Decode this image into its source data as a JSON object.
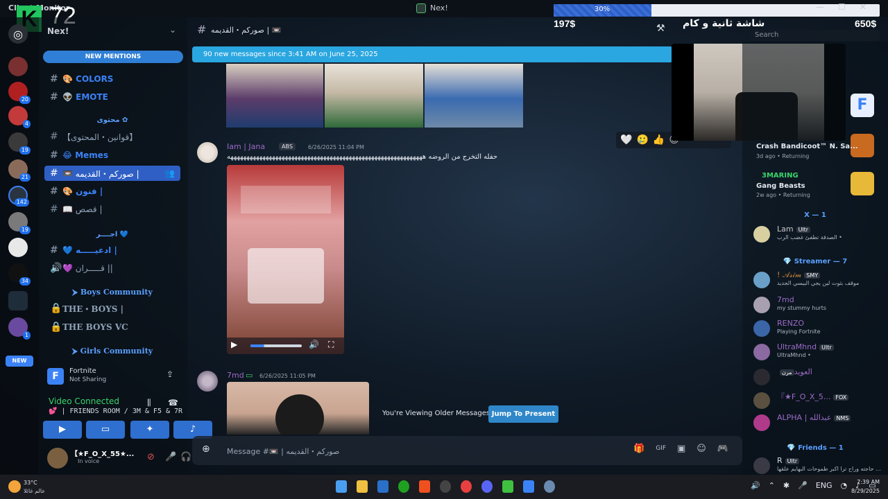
{
  "window": {
    "app_title": "Client Monitor",
    "title": "Nex!"
  },
  "overlay": {
    "logo": "K",
    "count": "72",
    "progress_label": "30%",
    "progress": 0.3,
    "left_amount": "197$",
    "right_amount": "650$",
    "goal_text": "شاشة ثانية و كام",
    "search_placeholder": "Search"
  },
  "server_rail": {
    "badges": [
      "20",
      "4",
      "19",
      "21",
      "142",
      "19",
      "34",
      "1"
    ],
    "new_label": "NEW"
  },
  "sidebar": {
    "server_name": "Nex!",
    "new_mentions": "NEW MENTIONS",
    "channels": [
      {
        "label": "COLORS",
        "emoji": "🎨"
      },
      {
        "label": "EMOTE",
        "emoji": "👽"
      },
      {
        "category": "محتوى ✿"
      },
      {
        "label": "【قوانين・المحتوى】"
      },
      {
        "label": "Memes",
        "emoji": "😂"
      },
      {
        "label": "صوركم・القديمه |",
        "emoji": "📼",
        "active": true
      },
      {
        "label": "فنون |",
        "emoji": "🎨"
      },
      {
        "label": "قصص |",
        "emoji": "📖"
      },
      {
        "category": "اجــــر 💙"
      },
      {
        "label": "ادعيـــــه |",
        "emoji": "💙"
      },
      {
        "label": "قـــــران ||",
        "emoji": "💜"
      },
      {
        "category": "⮞ Boys Community"
      },
      {
        "label": "THE・BOYS |"
      },
      {
        "label": "THE BOYS VC"
      },
      {
        "category": "⮞ Girls Community"
      }
    ],
    "game_activity": {
      "name": "Fortnite",
      "status": "Not Sharing"
    },
    "voice": {
      "status": "Video Connected",
      "room": "💕 | FRIENDS ROOM / 3M & F5 & 7R"
    },
    "user": {
      "name": "【★F_O_X_55★...",
      "status": "In voice"
    }
  },
  "chat": {
    "channel": "صوركم・القديمه | 📼",
    "new_messages_banner": "90 new messages since 3:41 AM on June 25, 2025",
    "messages": [
      {
        "author": "Iam | Jana",
        "tag": "ABS",
        "time": "6/26/2025 11:04 PM",
        "text": "حفله التخرج من الروضه هههههههههههههههههههههههههههههههههههههههههههههههههههههههههههههه"
      },
      {
        "author": "7md",
        "time": "6/26/2025 11:05 PM"
      }
    ],
    "older_notice": "You're Viewing Older Messages",
    "jump_label": "Jump To Present",
    "composer_placeholder": "Message #📼 | صوركم・القديمه"
  },
  "reactions": [
    "🤍",
    "🥲",
    "👍"
  ],
  "members": {
    "games": [
      {
        "title": "Crash Bandicoot™ N. Sa...",
        "meta": "3d ago • Returning"
      },
      {
        "publisher": "3MARING",
        "title": "Gang Beasts",
        "meta": "2w ago • Returning"
      }
    ],
    "sections": [
      {
        "title": "X — 1"
      },
      {
        "title": "💎 Streamer — 7"
      },
      {
        "title": "💎 Friends — 1"
      }
    ],
    "list": [
      {
        "name": "Lam",
        "tag": "Ultr",
        "sub": "الصدقة تطفئ غضب الرب •",
        "color": "#c8c8c8"
      },
      {
        "name": "! 𝒜𝓈𝒾𝓂",
        "tag": "SMY",
        "sub": "موقف بثوت لين يجي البيسي الجديد",
        "color": "#d08a3a"
      },
      {
        "name": "7md",
        "sub": "my stummy hurts",
        "color": "#9b6bc6"
      },
      {
        "name": "RENZO",
        "sub": "Playing Fortnite",
        "color": "#9b6bc6"
      },
      {
        "name": "UltraMhnd",
        "tag": "Ultr",
        "sub": "UltraMhnd •",
        "color": "#9b6bc6"
      },
      {
        "name": "العويد",
        "tag": "مرن",
        "color": "#9b6bc6"
      },
      {
        "name": "『★F_O_X_5...",
        "tag": "FOX",
        "color": "#9b6bc6"
      },
      {
        "name": "ALPHA | عبدالله",
        "tag": "NMS",
        "color": "#9b6bc6"
      },
      {
        "name": "R",
        "tag": "Ultr",
        "sub": "حاجته وراح ترا اكبر طموحات البهايم علقها ...",
        "color": "#d8dde6"
      }
    ]
  },
  "taskbar": {
    "temp": "33°C",
    "weather": "عالم غائلا",
    "lang": "ENG",
    "time": "7:39 AM",
    "date": "8/29/2025"
  }
}
